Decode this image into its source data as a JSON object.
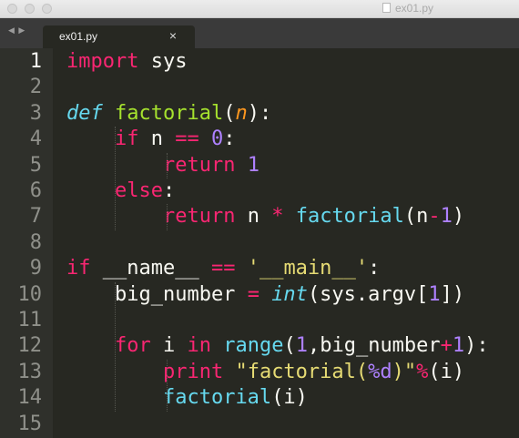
{
  "window": {
    "title": "ex01.py"
  },
  "tabs": [
    {
      "label": "ex01.py",
      "close": "×"
    }
  ],
  "nav_arrows": "◀ ▶",
  "colors": {
    "background": "#272822",
    "keyword": "#f92672",
    "string": "#e6db74",
    "number": "#ae81ff",
    "function": "#a6e22e",
    "storage": "#66d9ef",
    "param": "#fd971f",
    "text": "#f8f8f2"
  },
  "editor": {
    "lines": [
      {
        "num": "1",
        "tokens": [
          {
            "t": "import",
            "c": "k"
          },
          {
            "t": " sys",
            "c": "t"
          }
        ]
      },
      {
        "num": "2",
        "tokens": []
      },
      {
        "num": "3",
        "tokens": [
          {
            "t": "def",
            "c": "st"
          },
          {
            "t": " ",
            "c": "t"
          },
          {
            "t": "factorial",
            "c": "f"
          },
          {
            "t": "(",
            "c": "t"
          },
          {
            "t": "n",
            "c": "p"
          },
          {
            "t": "):",
            "c": "t"
          }
        ]
      },
      {
        "num": "4",
        "tokens": [
          {
            "t": "    ",
            "c": "t"
          },
          {
            "t": "if",
            "c": "k"
          },
          {
            "t": " n ",
            "c": "t"
          },
          {
            "t": "==",
            "c": "k"
          },
          {
            "t": " ",
            "c": "t"
          },
          {
            "t": "0",
            "c": "n"
          },
          {
            "t": ":",
            "c": "t"
          }
        ]
      },
      {
        "num": "5",
        "tokens": [
          {
            "t": "        ",
            "c": "t"
          },
          {
            "t": "return",
            "c": "k"
          },
          {
            "t": " ",
            "c": "t"
          },
          {
            "t": "1",
            "c": "n"
          }
        ]
      },
      {
        "num": "6",
        "tokens": [
          {
            "t": "    ",
            "c": "t"
          },
          {
            "t": "else",
            "c": "k"
          },
          {
            "t": ":",
            "c": "t"
          }
        ]
      },
      {
        "num": "7",
        "tokens": [
          {
            "t": "        ",
            "c": "t"
          },
          {
            "t": "return",
            "c": "k"
          },
          {
            "t": " n ",
            "c": "t"
          },
          {
            "t": "*",
            "c": "k"
          },
          {
            "t": " ",
            "c": "t"
          },
          {
            "t": "factorial",
            "c": "b"
          },
          {
            "t": "(n",
            "c": "t"
          },
          {
            "t": "-",
            "c": "k"
          },
          {
            "t": "1",
            "c": "n"
          },
          {
            "t": ")",
            "c": "t"
          }
        ]
      },
      {
        "num": "8",
        "tokens": []
      },
      {
        "num": "9",
        "tokens": [
          {
            "t": "if",
            "c": "k"
          },
          {
            "t": " __name__ ",
            "c": "t"
          },
          {
            "t": "==",
            "c": "k"
          },
          {
            "t": " ",
            "c": "t"
          },
          {
            "t": "'__main__'",
            "c": "s"
          },
          {
            "t": ":",
            "c": "t"
          }
        ]
      },
      {
        "num": "10",
        "tokens": [
          {
            "t": "    big_number ",
            "c": "t"
          },
          {
            "t": "=",
            "c": "k"
          },
          {
            "t": " ",
            "c": "t"
          },
          {
            "t": "int",
            "c": "st"
          },
          {
            "t": "(sys.argv[",
            "c": "t"
          },
          {
            "t": "1",
            "c": "n"
          },
          {
            "t": "])",
            "c": "t"
          }
        ]
      },
      {
        "num": "11",
        "tokens": []
      },
      {
        "num": "12",
        "tokens": [
          {
            "t": "    ",
            "c": "t"
          },
          {
            "t": "for",
            "c": "k"
          },
          {
            "t": " i ",
            "c": "t"
          },
          {
            "t": "in",
            "c": "k"
          },
          {
            "t": " ",
            "c": "t"
          },
          {
            "t": "range",
            "c": "b"
          },
          {
            "t": "(",
            "c": "t"
          },
          {
            "t": "1",
            "c": "n"
          },
          {
            "t": ",big_number",
            "c": "t"
          },
          {
            "t": "+",
            "c": "k"
          },
          {
            "t": "1",
            "c": "n"
          },
          {
            "t": "):",
            "c": "t"
          }
        ]
      },
      {
        "num": "13",
        "tokens": [
          {
            "t": "        ",
            "c": "t"
          },
          {
            "t": "print",
            "c": "k"
          },
          {
            "t": " ",
            "c": "t"
          },
          {
            "t": "\"factorial(",
            "c": "s"
          },
          {
            "t": "%d",
            "c": "n"
          },
          {
            "t": ")\"",
            "c": "s"
          },
          {
            "t": "%",
            "c": "k"
          },
          {
            "t": "(i)",
            "c": "t"
          }
        ]
      },
      {
        "num": "14",
        "tokens": [
          {
            "t": "        ",
            "c": "t"
          },
          {
            "t": "factorial",
            "c": "b"
          },
          {
            "t": "(i)",
            "c": "t"
          }
        ]
      },
      {
        "num": "15",
        "tokens": []
      }
    ]
  }
}
